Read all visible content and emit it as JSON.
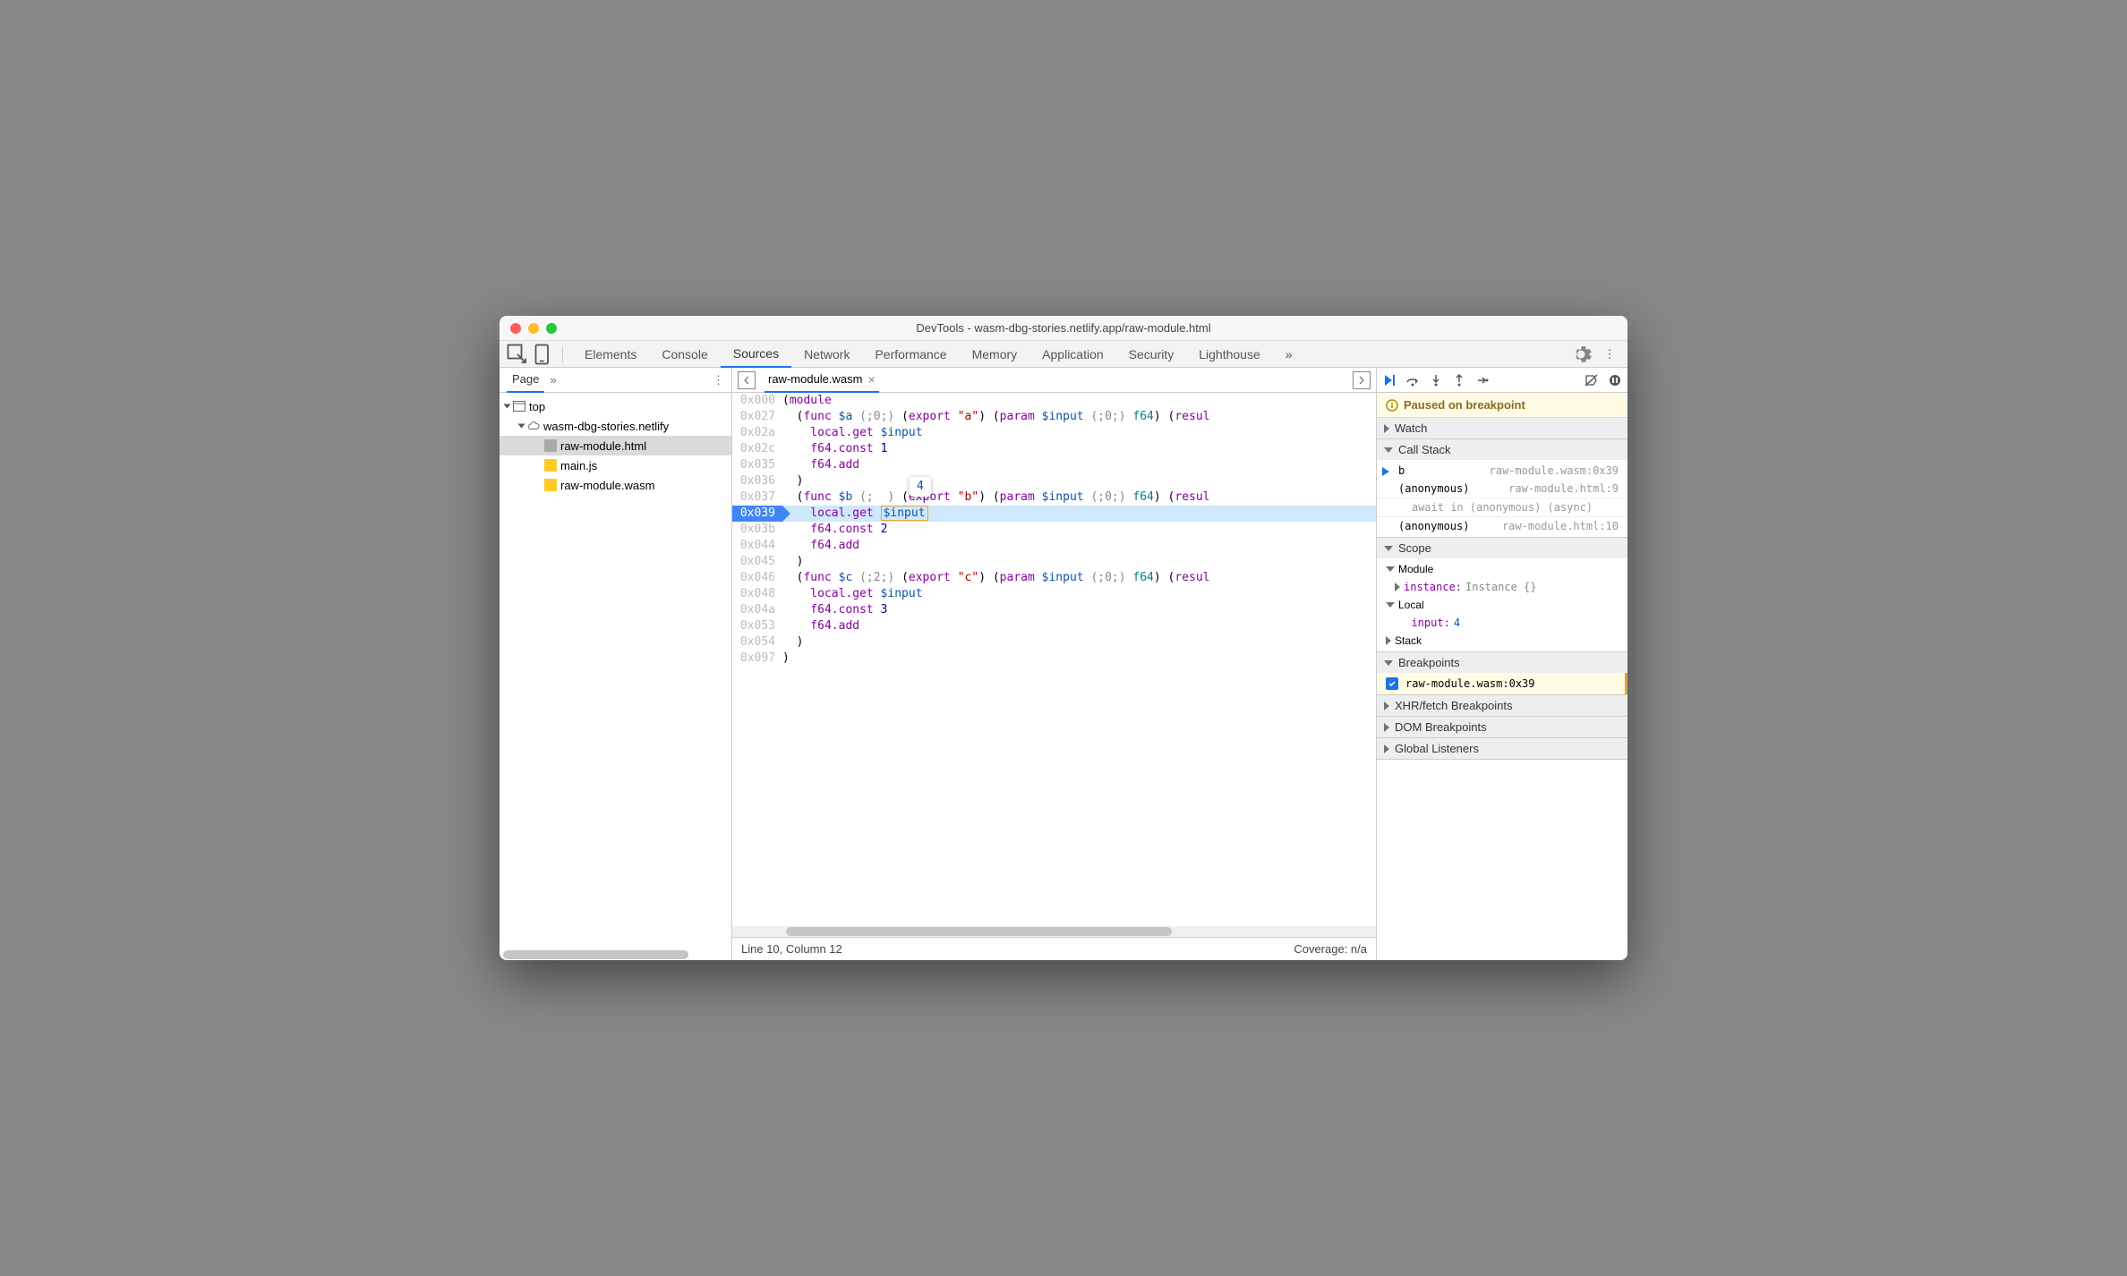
{
  "window": {
    "title": "DevTools - wasm-dbg-stories.netlify.app/raw-module.html"
  },
  "toolbar": {
    "tabs": [
      "Elements",
      "Console",
      "Sources",
      "Network",
      "Performance",
      "Memory",
      "Application",
      "Security",
      "Lighthouse"
    ],
    "active": "Sources"
  },
  "page": {
    "tab": "Page",
    "tree": {
      "root": "top",
      "domain": "wasm-dbg-stories.netlify",
      "files": [
        "raw-module.html",
        "main.js",
        "raw-module.wasm"
      ],
      "selected": "raw-module.html"
    }
  },
  "source": {
    "openFile": "raw-module.wasm",
    "tooltip": "4",
    "gutter": [
      "0x000",
      "0x027",
      "0x02a",
      "0x02c",
      "0x035",
      "0x036",
      "0x037",
      "0x039",
      "0x03b",
      "0x044",
      "0x045",
      "0x046",
      "0x048",
      "0x04a",
      "0x053",
      "0x054",
      "0x097"
    ],
    "code": [
      [
        [
          "(",
          "p"
        ],
        [
          "module",
          "k"
        ]
      ],
      [
        [
          "  (",
          "p"
        ],
        [
          "func",
          "k"
        ],
        [
          " ",
          "p"
        ],
        [
          "$a",
          "n"
        ],
        [
          " ",
          "p"
        ],
        [
          "(;0;)",
          "c"
        ],
        [
          " (",
          "p"
        ],
        [
          "export",
          "k"
        ],
        [
          " ",
          "p"
        ],
        [
          "\"a\"",
          "s"
        ],
        [
          ") (",
          "p"
        ],
        [
          "param",
          "k"
        ],
        [
          " ",
          "p"
        ],
        [
          "$input",
          "n"
        ],
        [
          " ",
          "p"
        ],
        [
          "(;0;)",
          "c"
        ],
        [
          " ",
          "p"
        ],
        [
          "f64",
          "t"
        ],
        [
          ") (",
          "p"
        ],
        [
          "resul",
          "k"
        ]
      ],
      [
        [
          "    local.get ",
          "k"
        ],
        [
          "$input",
          "n"
        ]
      ],
      [
        [
          "    f64.const ",
          "k"
        ],
        [
          "1",
          "cy"
        ]
      ],
      [
        [
          "    f64.add",
          "k"
        ]
      ],
      [
        [
          "  )",
          "p"
        ]
      ],
      [
        [
          "  (",
          "p"
        ],
        [
          "func",
          "k"
        ],
        [
          " ",
          "p"
        ],
        [
          "$b",
          "n"
        ],
        [
          " ",
          "p"
        ],
        [
          "(;  )",
          "c"
        ],
        [
          " (",
          "p"
        ],
        [
          "export",
          "k"
        ],
        [
          " ",
          "p"
        ],
        [
          "\"b\"",
          "s"
        ],
        [
          ") (",
          "p"
        ],
        [
          "param",
          "k"
        ],
        [
          " ",
          "p"
        ],
        [
          "$input",
          "n"
        ],
        [
          " ",
          "p"
        ],
        [
          "(;0;)",
          "c"
        ],
        [
          " ",
          "p"
        ],
        [
          "f64",
          "t"
        ],
        [
          ") (",
          "p"
        ],
        [
          "resul",
          "k"
        ]
      ],
      [
        [
          "    local.get ",
          "k"
        ],
        [
          "$input",
          "nb"
        ]
      ],
      [
        [
          "    f64.const ",
          "k"
        ],
        [
          "2",
          "cy"
        ]
      ],
      [
        [
          "    f64.add",
          "k"
        ]
      ],
      [
        [
          "  )",
          "p"
        ]
      ],
      [
        [
          "  (",
          "p"
        ],
        [
          "func",
          "k"
        ],
        [
          " ",
          "p"
        ],
        [
          "$c",
          "n"
        ],
        [
          " ",
          "p"
        ],
        [
          "(;2;)",
          "c"
        ],
        [
          " (",
          "p"
        ],
        [
          "export",
          "k"
        ],
        [
          " ",
          "p"
        ],
        [
          "\"c\"",
          "s"
        ],
        [
          ") (",
          "p"
        ],
        [
          "param",
          "k"
        ],
        [
          " ",
          "p"
        ],
        [
          "$input",
          "n"
        ],
        [
          " ",
          "p"
        ],
        [
          "(;0;)",
          "c"
        ],
        [
          " ",
          "p"
        ],
        [
          "f64",
          "t"
        ],
        [
          ") (",
          "p"
        ],
        [
          "resul",
          "k"
        ]
      ],
      [
        [
          "    local.get ",
          "k"
        ],
        [
          "$input",
          "n"
        ]
      ],
      [
        [
          "    f64.const ",
          "k"
        ],
        [
          "3",
          "cy"
        ]
      ],
      [
        [
          "    f64.add",
          "k"
        ]
      ],
      [
        [
          "  )",
          "p"
        ]
      ],
      [
        [
          ")",
          "p"
        ]
      ]
    ],
    "highlightedLine": 7,
    "statusLeft": "Line 10, Column 12",
    "statusRight": "Coverage: n/a"
  },
  "debug": {
    "pauseMsg": "Paused on breakpoint",
    "sections": {
      "watch": "Watch",
      "callstack": "Call Stack",
      "scope": "Scope",
      "breakpoints": "Breakpoints",
      "xhr": "XHR/fetch Breakpoints",
      "dom": "DOM Breakpoints",
      "global": "Global Listeners"
    },
    "callstack": [
      {
        "fn": "b",
        "loc": "raw-module.wasm:0x39",
        "current": true
      },
      {
        "fn": "(anonymous)",
        "loc": "raw-module.html:9"
      },
      {
        "async": "await in (anonymous) (async)"
      },
      {
        "fn": "(anonymous)",
        "loc": "raw-module.html:10"
      }
    ],
    "scope": {
      "module_label": "Module",
      "instance_label": "instance:",
      "instance_value": "Instance {}",
      "local_label": "Local",
      "input_label": "input:",
      "input_value": "4",
      "stack_label": "Stack"
    },
    "breakpoint": "raw-module.wasm:0x39"
  }
}
